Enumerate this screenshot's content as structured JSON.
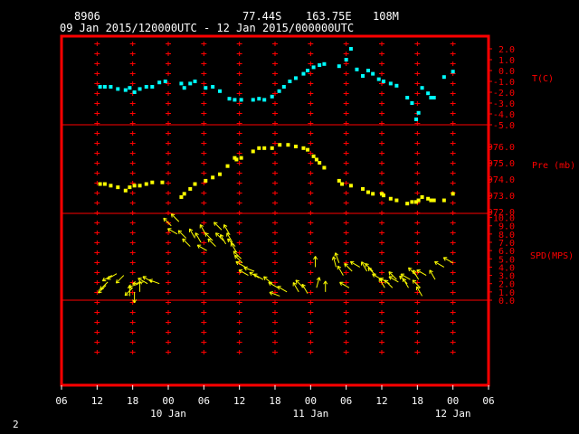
{
  "header": {
    "station_id": "8906",
    "latitude": "77.44S",
    "longitude": "163.75E",
    "elevation": "108M",
    "time_range": "09 Jan 2015/120000UTC - 12 Jan 2015/000000UTC"
  },
  "page_number": "2",
  "colors": {
    "frame": "#ff0000",
    "temperature": "#00ffff",
    "pressure": "#ffff00",
    "wind": "#ffff00",
    "text": "#ffffff"
  },
  "chart_data": {
    "type": "scatter",
    "x_axis": {
      "tick_labels": [
        "06",
        "12",
        "18",
        "00",
        "06",
        "12",
        "18",
        "00",
        "06",
        "12",
        "18",
        "00",
        "06"
      ],
      "date_labels": [
        "10 Jan",
        "11 Jan",
        "12 Jan"
      ],
      "range": [
        "2015-01-10 06:00 UTC",
        "2015-01-12 06:00 UTC"
      ]
    },
    "panels": [
      {
        "name": "T(C)",
        "ylim": [
          -5.0,
          2.5
        ],
        "tick_labels": [
          "2.0",
          "1.0",
          "0.0",
          "-1.0",
          "-2.0",
          "-3.0",
          "-4.0",
          "-5.0"
        ],
        "tick_values": [
          2,
          1,
          0,
          -1,
          -2,
          -3,
          -4,
          -5
        ],
        "points": [
          [
            12.5,
            -1.5
          ],
          [
            13.3,
            -1.5
          ],
          [
            14.3,
            -1.5
          ],
          [
            15.5,
            -1.7
          ],
          [
            16.8,
            -1.8
          ],
          [
            17.5,
            -1.6
          ],
          [
            18.3,
            -2.0
          ],
          [
            19.2,
            -1.7
          ],
          [
            20.3,
            -1.5
          ],
          [
            21.3,
            -1.5
          ],
          [
            22.5,
            -1.1
          ],
          [
            23.5,
            -1.0
          ],
          [
            26.2,
            -1.2
          ],
          [
            26.7,
            -1.6
          ],
          [
            27.7,
            -1.2
          ],
          [
            28.5,
            -1.0
          ],
          [
            30.3,
            -1.6
          ],
          [
            31.5,
            -1.5
          ],
          [
            32.7,
            -1.9
          ],
          [
            34.3,
            -2.6
          ],
          [
            35.2,
            -2.7
          ],
          [
            36.3,
            -2.7
          ],
          [
            38.3,
            -2.7
          ],
          [
            39.3,
            -2.6
          ],
          [
            40.2,
            -2.7
          ],
          [
            41.5,
            -2.4
          ],
          [
            42.7,
            -1.9
          ],
          [
            43.5,
            -1.5
          ],
          [
            44.5,
            -1.0
          ],
          [
            45.5,
            -0.7
          ],
          [
            46.8,
            -0.3
          ],
          [
            47.5,
            0.0
          ],
          [
            48.5,
            0.3
          ],
          [
            49.5,
            0.5
          ],
          [
            50.3,
            0.6
          ],
          [
            52.8,
            0.4
          ],
          [
            54.0,
            1.0
          ],
          [
            54.8,
            2.0
          ],
          [
            55.8,
            0.1
          ],
          [
            56.8,
            -0.5
          ],
          [
            57.7,
            0.0
          ],
          [
            58.5,
            -0.3
          ],
          [
            59.5,
            -0.8
          ],
          [
            60.3,
            -1.0
          ],
          [
            61.5,
            -1.2
          ],
          [
            62.5,
            -1.4
          ],
          [
            64.3,
            -2.5
          ],
          [
            65.1,
            -3.0
          ],
          [
            65.8,
            -4.5
          ],
          [
            66.2,
            -3.9
          ],
          [
            66.8,
            -1.6
          ],
          [
            67.8,
            -2.1
          ],
          [
            68.3,
            -2.5
          ],
          [
            68.8,
            -2.5
          ],
          [
            70.5,
            -0.6
          ],
          [
            72.0,
            -0.1
          ]
        ]
      },
      {
        "name": "Pre (mb)",
        "ylim": [
          971.9,
          976.5
        ],
        "tick_labels": [
          "976.0",
          "975.0",
          "974.0",
          "973.0",
          "972.0"
        ],
        "tick_values": [
          976,
          975,
          974,
          973,
          972
        ],
        "points": [
          [
            12.5,
            973.7
          ],
          [
            13.3,
            973.7
          ],
          [
            14.3,
            973.6
          ],
          [
            15.5,
            973.5
          ],
          [
            16.8,
            973.3
          ],
          [
            17.5,
            973.5
          ],
          [
            18.3,
            973.6
          ],
          [
            19.2,
            973.6
          ],
          [
            20.3,
            973.7
          ],
          [
            21.3,
            973.8
          ],
          [
            23.0,
            973.8
          ],
          [
            26.2,
            972.9
          ],
          [
            26.7,
            973.1
          ],
          [
            27.7,
            973.4
          ],
          [
            28.5,
            973.7
          ],
          [
            30.3,
            973.9
          ],
          [
            31.5,
            974.1
          ],
          [
            32.7,
            974.3
          ],
          [
            34.0,
            974.8
          ],
          [
            35.2,
            975.3
          ],
          [
            35.5,
            975.2
          ],
          [
            36.3,
            975.3
          ],
          [
            38.3,
            975.7
          ],
          [
            39.3,
            975.9
          ],
          [
            40.2,
            975.9
          ],
          [
            41.5,
            975.9
          ],
          [
            42.8,
            976.1
          ],
          [
            44.2,
            976.1
          ],
          [
            45.5,
            976.0
          ],
          [
            46.8,
            975.9
          ],
          [
            47.5,
            975.8
          ],
          [
            48.5,
            975.4
          ],
          [
            49.0,
            975.2
          ],
          [
            49.5,
            975.0
          ],
          [
            50.3,
            974.7
          ],
          [
            52.8,
            973.9
          ],
          [
            53.3,
            973.7
          ],
          [
            54.8,
            973.6
          ],
          [
            56.8,
            973.4
          ],
          [
            57.7,
            973.2
          ],
          [
            58.5,
            973.1
          ],
          [
            60.0,
            973.1
          ],
          [
            60.3,
            973.0
          ],
          [
            61.5,
            972.8
          ],
          [
            62.5,
            972.7
          ],
          [
            64.3,
            972.5
          ],
          [
            65.1,
            972.6
          ],
          [
            65.8,
            972.6
          ],
          [
            66.2,
            972.7
          ],
          [
            66.8,
            972.9
          ],
          [
            67.8,
            972.8
          ],
          [
            68.3,
            972.7
          ],
          [
            68.8,
            972.7
          ],
          [
            70.5,
            972.7
          ],
          [
            72.0,
            973.1
          ]
        ]
      },
      {
        "name": "SPD(MPS)",
        "ylim": [
          0.0,
          10.5
        ],
        "tick_labels": [
          "10.0",
          "9.0",
          "8.0",
          "7.0",
          "6.0",
          "5.0",
          "4.0",
          "3.0",
          "2.0",
          "1.0",
          "0.0"
        ],
        "tick_values": [
          10,
          9,
          8,
          7,
          6,
          5,
          4,
          3,
          2,
          1,
          0
        ],
        "points": [
          [
            13.5,
            1.8,
            225
          ],
          [
            13.8,
            2.2,
            225
          ],
          [
            14.5,
            3.0,
            240
          ],
          [
            15.3,
            3.2,
            240
          ],
          [
            16.5,
            3.0,
            225
          ],
          [
            17.5,
            0.5,
            0
          ],
          [
            18.0,
            1.5,
            225
          ],
          [
            18.3,
            1.0,
            180
          ],
          [
            19.0,
            2.0,
            250
          ],
          [
            19.2,
            1.0,
            0
          ],
          [
            19.8,
            2.2,
            260
          ],
          [
            20.5,
            2.0,
            300
          ],
          [
            21.3,
            2.2,
            300
          ],
          [
            22.5,
            2.0,
            290
          ],
          [
            24.5,
            9.0,
            315
          ],
          [
            25.5,
            8.0,
            300
          ],
          [
            25.8,
            9.5,
            315
          ],
          [
            27.0,
            7.5,
            315
          ],
          [
            27.7,
            6.5,
            315
          ],
          [
            28.5,
            7.5,
            330
          ],
          [
            29.5,
            7.0,
            330
          ],
          [
            30.3,
            8.0,
            330
          ],
          [
            30.5,
            6.0,
            300
          ],
          [
            31.5,
            7.2,
            315
          ],
          [
            32.0,
            6.5,
            315
          ],
          [
            33.0,
            8.5,
            315
          ],
          [
            33.3,
            7.2,
            315
          ],
          [
            33.7,
            6.8,
            330
          ],
          [
            34.3,
            8.0,
            330
          ],
          [
            34.8,
            7.0,
            330
          ],
          [
            35.3,
            6.5,
            315
          ],
          [
            35.5,
            5.8,
            330
          ],
          [
            36.3,
            5.0,
            315
          ],
          [
            36.5,
            4.5,
            315
          ],
          [
            37.0,
            4.0,
            300
          ],
          [
            37.5,
            3.0,
            300
          ],
          [
            38.5,
            3.5,
            290
          ],
          [
            39.3,
            2.7,
            300
          ],
          [
            40.0,
            2.5,
            300
          ],
          [
            41.5,
            2.0,
            310
          ],
          [
            42.5,
            1.5,
            300
          ],
          [
            42.8,
            0.5,
            290
          ],
          [
            44.0,
            1.0,
            300
          ],
          [
            46.0,
            1.0,
            330
          ],
          [
            46.8,
            1.5,
            315
          ],
          [
            47.5,
            0.8,
            330
          ],
          [
            48.8,
            4.0,
            0
          ],
          [
            49.0,
            1.5,
            15
          ],
          [
            50.5,
            1.0,
            0
          ],
          [
            52.3,
            4.0,
            345
          ],
          [
            52.8,
            4.5,
            340
          ],
          [
            53.5,
            3.0,
            330
          ],
          [
            54.5,
            1.5,
            300
          ],
          [
            55.0,
            3.5,
            315
          ],
          [
            56.3,
            4.0,
            300
          ],
          [
            57.5,
            3.5,
            330
          ],
          [
            58.5,
            3.5,
            315
          ],
          [
            59.0,
            3.0,
            315
          ],
          [
            60.0,
            2.5,
            300
          ],
          [
            60.5,
            1.5,
            330
          ],
          [
            61.3,
            2.0,
            300
          ],
          [
            61.8,
            1.5,
            315
          ],
          [
            62.5,
            2.5,
            315
          ],
          [
            62.8,
            2.2,
            300
          ],
          [
            64.3,
            2.0,
            315
          ],
          [
            64.5,
            1.5,
            330
          ],
          [
            64.8,
            2.5,
            300
          ],
          [
            65.8,
            3.0,
            315
          ],
          [
            66.2,
            2.5,
            330
          ],
          [
            66.5,
            1.5,
            315
          ],
          [
            66.8,
            0.5,
            330
          ],
          [
            67.5,
            3.0,
            300
          ],
          [
            69.0,
            2.5,
            330
          ],
          [
            70.5,
            4.0,
            300
          ],
          [
            72.0,
            4.5,
            300
          ]
        ]
      }
    ]
  }
}
